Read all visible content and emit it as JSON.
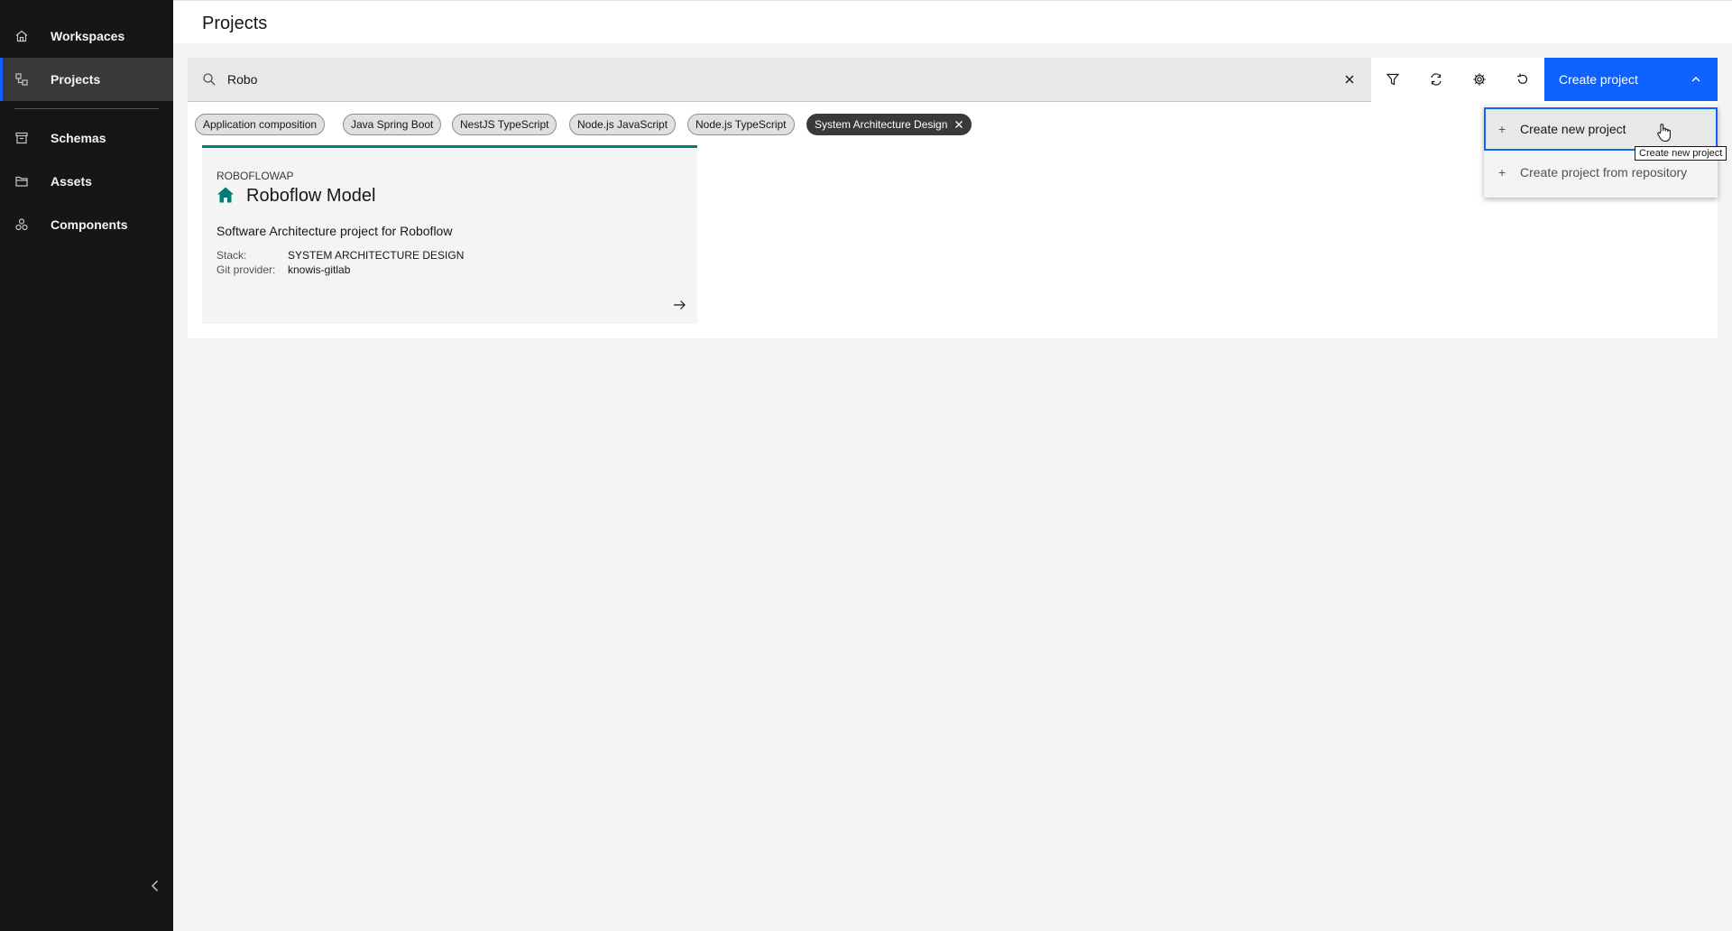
{
  "sidebar": {
    "items": [
      {
        "label": "Workspaces",
        "icon": "home-icon"
      },
      {
        "label": "Projects",
        "icon": "projects-icon"
      },
      {
        "label": "Schemas",
        "icon": "archive-icon"
      },
      {
        "label": "Assets",
        "icon": "folder-icon"
      },
      {
        "label": "Components",
        "icon": "components-icon"
      }
    ],
    "active": "Projects"
  },
  "header": {
    "title": "Projects"
  },
  "search": {
    "value": "Robo",
    "placeholder": ""
  },
  "toolbar": {
    "create_label": "Create project"
  },
  "tags": [
    {
      "label": "Application composition",
      "selected": false
    },
    {
      "label": "Java Spring Boot",
      "selected": false
    },
    {
      "label": "NestJS TypeScript",
      "selected": false
    },
    {
      "label": "Node.js JavaScript",
      "selected": false
    },
    {
      "label": "Node.js TypeScript",
      "selected": false
    },
    {
      "label": "System Architecture Design",
      "selected": true
    }
  ],
  "card": {
    "overline": "ROBOFLOWAP",
    "title": "Roboflow Model",
    "description": "Software Architecture project for Roboflow",
    "stack_key": "Stack:",
    "stack_value": "SYSTEM ARCHITECTURE DESIGN",
    "git_key": "Git provider:",
    "git_value": "knowis-gitlab"
  },
  "dropdown": {
    "items": [
      {
        "label": "Create new project"
      },
      {
        "label": "Create project from repository"
      }
    ]
  },
  "tooltip": "Create new project",
  "colors": {
    "accent": "#0f62fe",
    "teal": "#007d79",
    "sidebar_bg": "#161616"
  }
}
